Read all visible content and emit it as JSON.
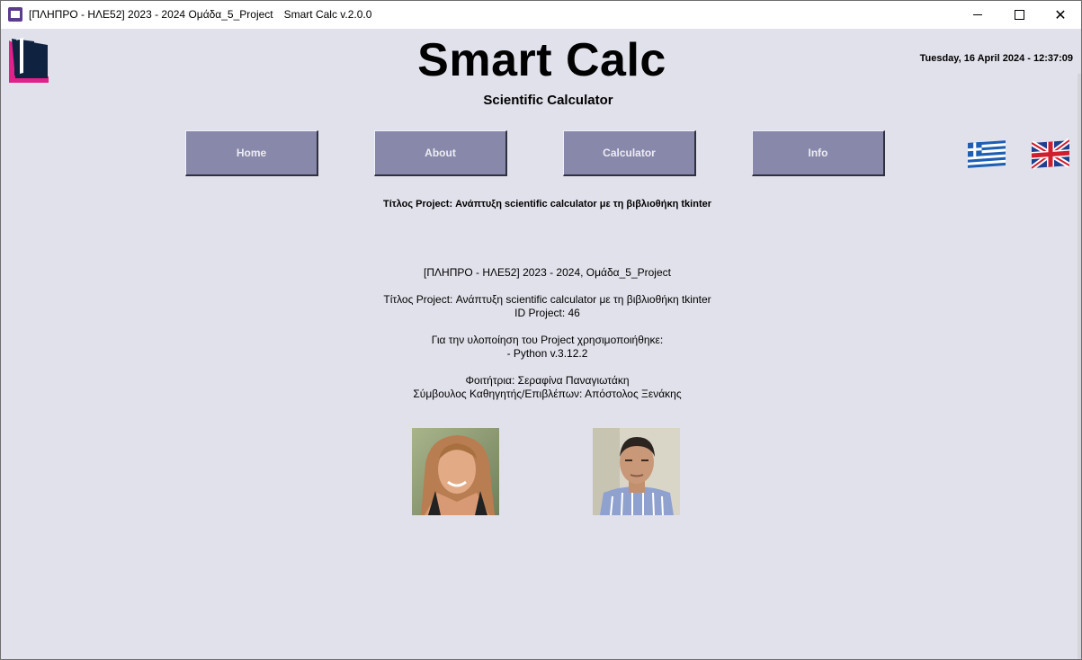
{
  "window": {
    "title_left": "[ΠΛΗΠΡΟ - ΗΛΕ52] 2023 - 2024 Ομάδα_5_Project",
    "title_right": "Smart Calc v.2.0.0"
  },
  "header": {
    "title": "Smart Calc",
    "subtitle": "Scientific Calculator",
    "datetime": "Tuesday, 16 April 2024 - 12:37:09"
  },
  "nav": {
    "home": "Home",
    "about": "About",
    "calculator": "Calculator",
    "info": "Info"
  },
  "languages": [
    "greek-flag-icon",
    "uk-flag-icon"
  ],
  "project_heading": "Τίτλος Project: Ανάπτυξη scientific calculator με τη βιβλιοθήκη tkinter",
  "info": {
    "line1": "[ΠΛΗΠΡΟ - ΗΛΕ52] 2023 - 2024, Ομάδα_5_Project",
    "line2": "Τίτλος Project: Ανάπτυξη scientific calculator με τη βιβλιοθήκη tkinter",
    "line3": "ID Project: 46",
    "line4": "Για την υλοποίηση του Project χρησιμοποιήθηκε:",
    "line5": "- Python v.3.12.2",
    "line6": "Φοιτήτρια: Σεραφίνα Παναγιωτάκη",
    "line7": "Σύμβουλος Καθηγητής/Επιβλέπων: Απόστολος Ξενάκης"
  },
  "colors": {
    "background": "#e1e1eb",
    "button": "#8888aa",
    "button_text": "#ececf4",
    "logo_pink": "#e0218a",
    "logo_navy": "#0f2340"
  }
}
